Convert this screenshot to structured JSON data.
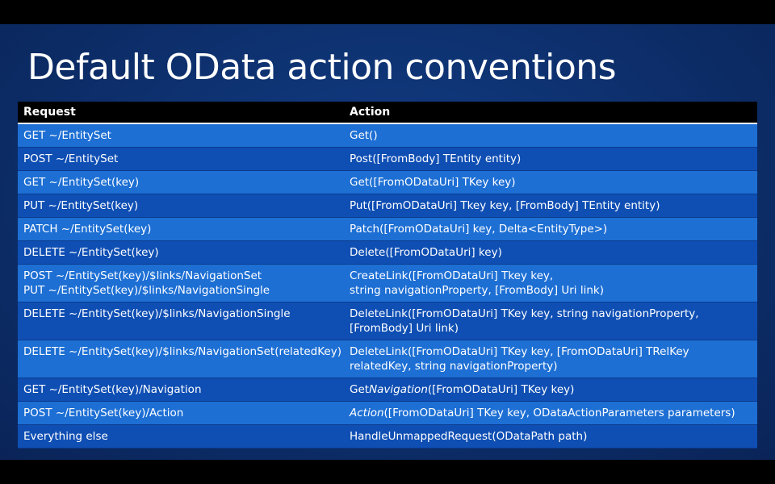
{
  "slide": {
    "title": "Default OData action conventions"
  },
  "table": {
    "headers": {
      "request": "Request",
      "action": "Action"
    },
    "rows": [
      {
        "request": "GET ~/EntitySet",
        "action_pre": "Get()",
        "action_em": "",
        "action_post": ""
      },
      {
        "request": "POST ~/EntitySet",
        "action_pre": "Post([FromBody] TEntity entity)",
        "action_em": "",
        "action_post": ""
      },
      {
        "request": "GET ~/EntitySet(key)",
        "action_pre": "Get([FromODataUri] TKey key)",
        "action_em": "",
        "action_post": ""
      },
      {
        "request": "PUT ~/EntitySet(key)",
        "action_pre": "Put([FromODataUri] Tkey key, [FromBody] TEntity entity)",
        "action_em": "",
        "action_post": ""
      },
      {
        "request": "PATCH ~/EntitySet(key)",
        "action_pre": "Patch([FromODataUri] key, Delta<EntityType>)",
        "action_em": "",
        "action_post": ""
      },
      {
        "request": "DELETE ~/EntitySet(key)",
        "action_pre": "Delete([FromODataUri] key)",
        "action_em": "",
        "action_post": ""
      },
      {
        "request": "POST ~/EntitySet(key)/$links/NavigationSet\nPUT ~/EntitySet(key)/$links/NavigationSingle",
        "action_pre": "CreateLink([FromODataUri] Tkey key,\nstring navigationProperty, [FromBody] Uri link)",
        "action_em": "",
        "action_post": ""
      },
      {
        "request": "DELETE ~/EntitySet(key)/$links/NavigationSingle",
        "action_pre": "DeleteLink([FromODataUri] TKey key, string navigationProperty,\n[FromBody] Uri link)",
        "action_em": "",
        "action_post": ""
      },
      {
        "request": "DELETE ~/EntitySet(key)/$links/NavigationSet(relatedKey)",
        "action_pre": "DeleteLink([FromODataUri] TKey key, [FromODataUri] TRelKey\nrelatedKey, string navigationProperty)",
        "action_em": "",
        "action_post": ""
      },
      {
        "request": "GET ~/EntitySet(key)/Navigation",
        "action_pre": "Get",
        "action_em": "Navigation",
        "action_post": "([FromODataUri] TKey key)"
      },
      {
        "request": "POST ~/EntitySet(key)/Action",
        "action_pre": "",
        "action_em": "Action",
        "action_post": "([FromODataUri] TKey key, ODataActionParameters parameters)"
      },
      {
        "request": "Everything else",
        "action_pre": "HandleUnmappedRequest(ODataPath path)",
        "action_em": "",
        "action_post": ""
      }
    ]
  },
  "colors": {
    "row_light": "#1d6fd4",
    "row_dark": "#0f4fb4",
    "header_bg": "#000000",
    "slide_bg": "#0d2f6c"
  }
}
